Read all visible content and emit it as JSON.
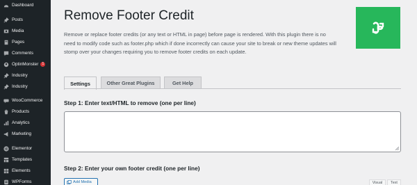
{
  "sidebar": {
    "items": [
      {
        "label": "Dashboard",
        "icon": "dashboard-icon"
      },
      {
        "label": "Posts",
        "icon": "pin-icon"
      },
      {
        "label": "Media",
        "icon": "media-icon"
      },
      {
        "label": "Pages",
        "icon": "pages-icon"
      },
      {
        "label": "Comments",
        "icon": "comments-icon"
      },
      {
        "label": "OptinMonster",
        "icon": "optinmonster-icon",
        "badge": "1"
      },
      {
        "label": "Industry",
        "icon": "pin-icon"
      },
      {
        "label": "Industry",
        "icon": "pin-icon"
      },
      {
        "label": "WooCommerce",
        "icon": "woocommerce-icon"
      },
      {
        "label": "Products",
        "icon": "products-icon"
      },
      {
        "label": "Analytics",
        "icon": "analytics-icon"
      },
      {
        "label": "Marketing",
        "icon": "marketing-icon"
      },
      {
        "label": "Elementor",
        "icon": "elementor-icon"
      },
      {
        "label": "Templates",
        "icon": "templates-icon"
      },
      {
        "label": "Elements",
        "icon": "elements-icon"
      },
      {
        "label": "WPForms",
        "icon": "wpforms-icon"
      }
    ]
  },
  "page": {
    "title": "Remove Footer Credit",
    "description": "Remove or replace footer credits (or any text or HTML in page) before page is rendered. With this plugin there is no need to modify code such as footer.php which if done incorrectly can cause your site to break or new theme updates will stomp over your changes requiring you to remove footer credits on each update."
  },
  "tabs": [
    "Settings",
    "Other Great Plugins",
    "Get Help"
  ],
  "step1": {
    "label": "Step 1: Enter text/HTML to remove (one per line)",
    "value": ""
  },
  "step2": {
    "label": "Step 2: Enter your own footer credit (one per line)"
  },
  "editor": {
    "add_media": "Add Media",
    "visual": "Visual",
    "text": "Text"
  },
  "colors": {
    "sidebar": "#1d2327",
    "accent": "#2271b1",
    "logo_bg": "#27b75b",
    "badge": "#d63638"
  }
}
